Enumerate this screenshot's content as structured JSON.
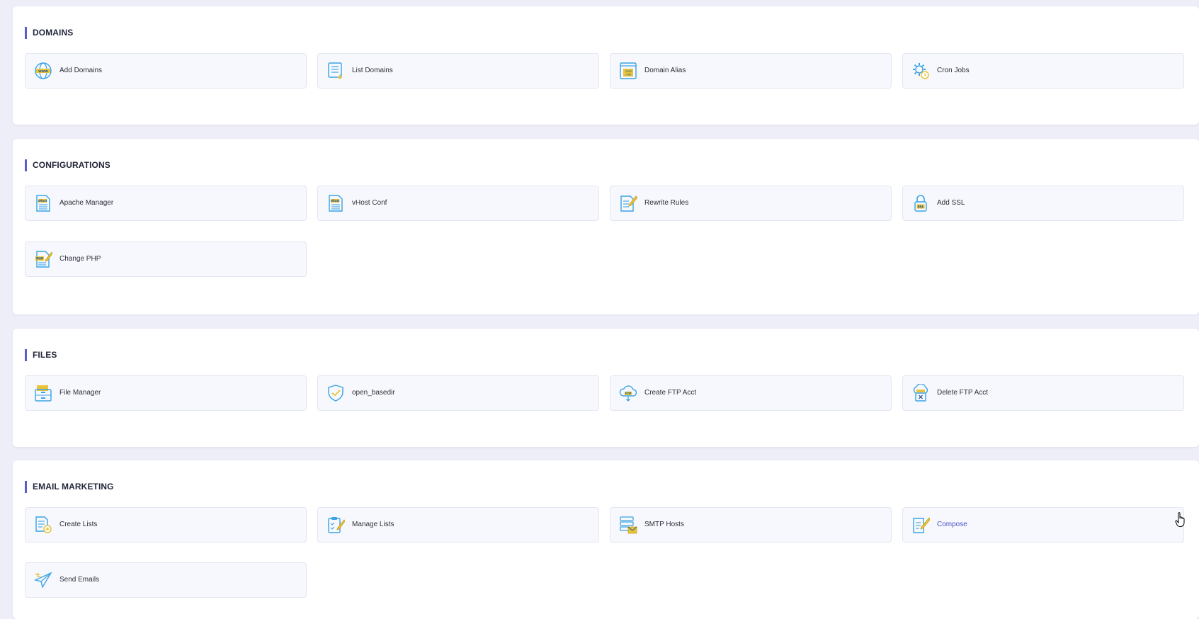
{
  "sections": [
    {
      "title": "DOMAINS",
      "cards": [
        {
          "label": "Add Domains",
          "icon": "www-globe-icon"
        },
        {
          "label": "List Domains",
          "icon": "list-document-icon"
        },
        {
          "label": "Domain Alias",
          "icon": "domain-alias-icon"
        },
        {
          "label": "Cron Jobs",
          "icon": "gear-clock-icon"
        }
      ]
    },
    {
      "title": "CONFIGURATIONS",
      "cards": [
        {
          "label": "Apache Manager",
          "icon": "vhost-document-icon"
        },
        {
          "label": "vHost Conf",
          "icon": "vhost-document-icon"
        },
        {
          "label": "Rewrite Rules",
          "icon": "document-pencil-icon"
        },
        {
          "label": "Add SSL",
          "icon": "ssl-lock-icon"
        },
        {
          "label": "Change PHP",
          "icon": "php-document-icon"
        }
      ]
    },
    {
      "title": "FILES",
      "cards": [
        {
          "label": "File Manager",
          "icon": "file-cabinet-icon"
        },
        {
          "label": "open_basedir",
          "icon": "shield-icon"
        },
        {
          "label": "Create FTP Acct",
          "icon": "ftp-cloud-icon"
        },
        {
          "label": "Delete FTP Acct",
          "icon": "ftp-delete-icon"
        }
      ]
    },
    {
      "title": "EMAIL MARKETING",
      "cards": [
        {
          "label": "Create Lists",
          "icon": "list-add-icon"
        },
        {
          "label": "Manage Lists",
          "icon": "clipboard-pencil-icon"
        },
        {
          "label": "SMTP Hosts",
          "icon": "smtp-server-icon"
        },
        {
          "label": "Compose",
          "icon": "compose-pencil-icon"
        },
        {
          "label": "Send Emails",
          "icon": "paper-plane-icon"
        }
      ]
    }
  ],
  "colors": {
    "accent": "#5b5fc7",
    "icon_blue": "#3aa3e3",
    "icon_yellow": "#e8c33a",
    "hover_text": "#4a52c9"
  },
  "hovered_card": "Compose"
}
